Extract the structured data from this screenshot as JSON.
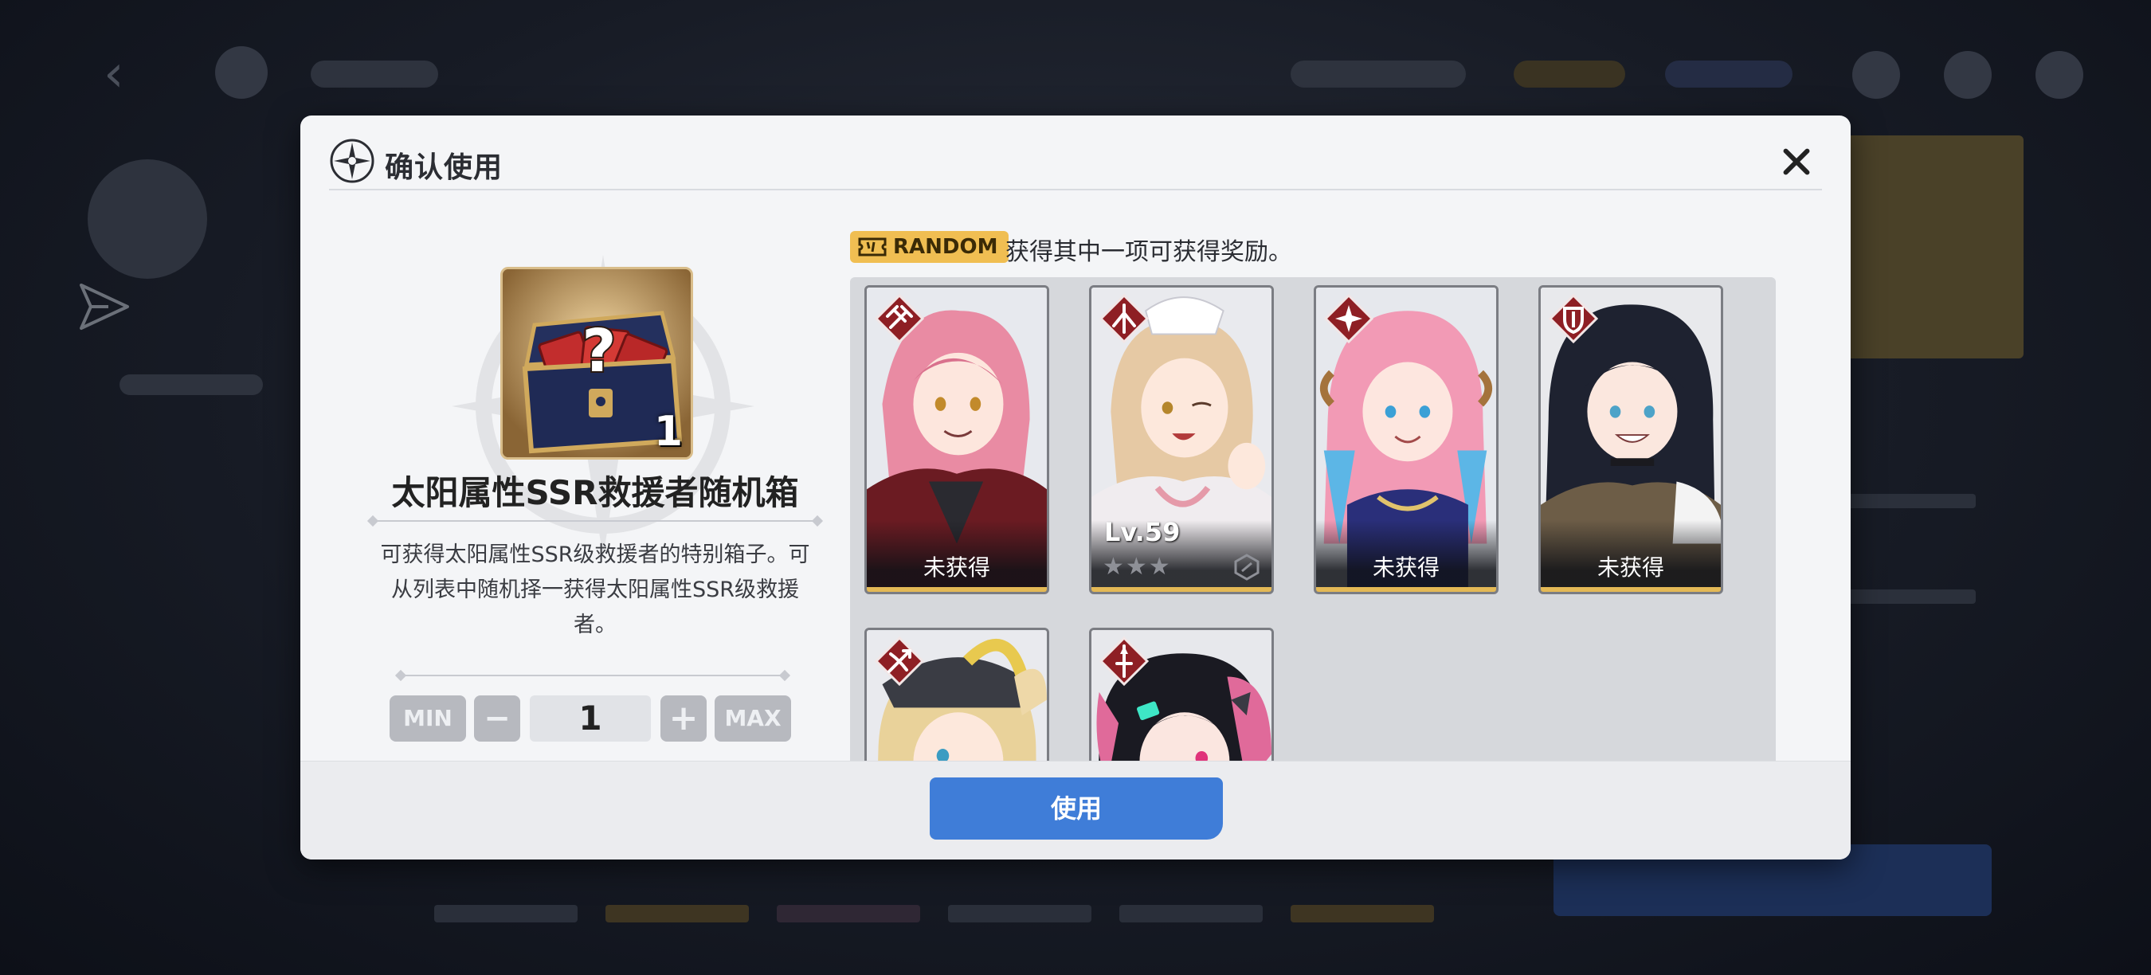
{
  "dialog": {
    "title": "确认使用",
    "close_icon": "close-icon"
  },
  "item": {
    "name": "太阳属性SSR救援者随机箱",
    "count": "1",
    "description": "可获得太阳属性SSR级救援者的特别箱子。可从列表中随机择一获得太阳属性SSR级救援者。",
    "icon": "chest-icon"
  },
  "stepper": {
    "min_label": "MIN",
    "minus_label": "−",
    "value": "1",
    "plus_label": "+",
    "max_label": "MAX"
  },
  "reward": {
    "tag_label": "RANDOM",
    "description": "获得其中一项可获得奖励。"
  },
  "characters": [
    {
      "class_icon": "hammer-class-icon",
      "status": "未获得",
      "hair": "#e98ba3",
      "accent": "#6b1b22"
    },
    {
      "class_icon": "crosshair-class-icon",
      "level": "Lv.59",
      "stars": "★★★",
      "hair": "#e6c9a4",
      "accent": "#f0ecef"
    },
    {
      "class_icon": "star-class-icon",
      "status": "未获得",
      "hair": "#f29ab5",
      "accent": "#2a2f7a"
    },
    {
      "class_icon": "shield-class-icon",
      "status": "未获得",
      "hair": "#1e2230",
      "accent": "#6d5d47"
    },
    {
      "class_icon": "bow-class-icon",
      "hair": "#e9d29a",
      "accent": "#3a3c44"
    },
    {
      "class_icon": "sword-class-icon",
      "hair": "#1a1a22",
      "accent": "#e06a9a"
    }
  ],
  "footer": {
    "use_label": "使用"
  },
  "colors": {
    "accent_blue": "#3f7dd8",
    "random_gold": "#f0be52",
    "card_gold": "#e4b956",
    "class_badge_red": "#8e1f24"
  }
}
